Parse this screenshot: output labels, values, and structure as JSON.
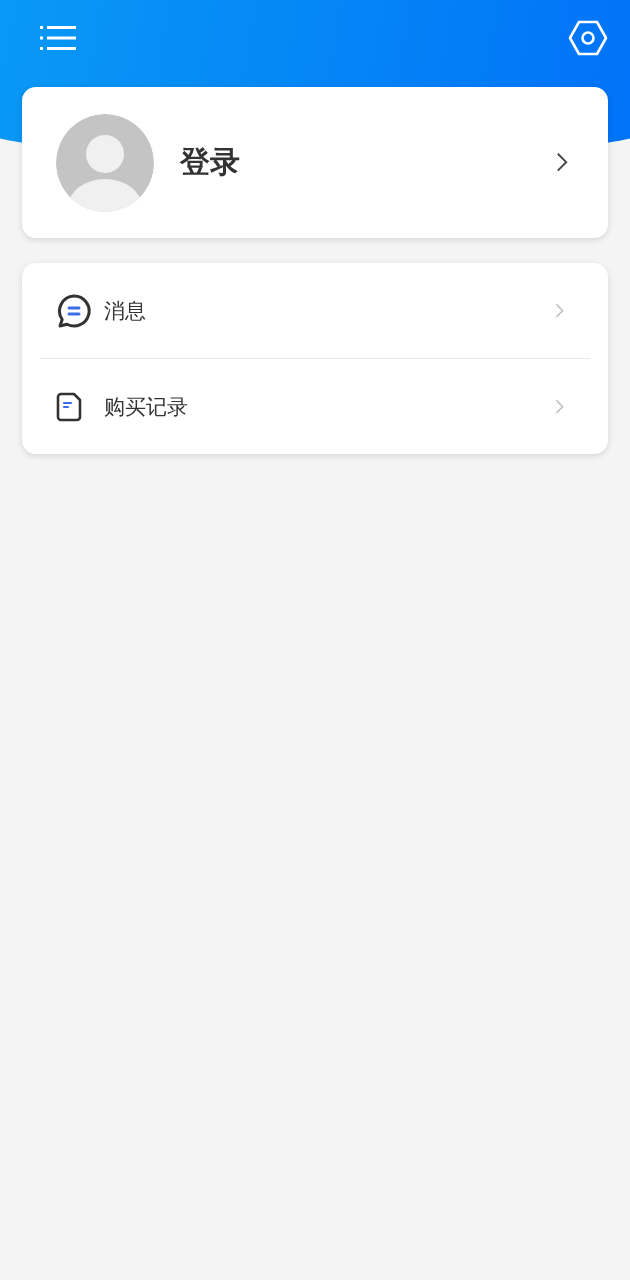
{
  "profile": {
    "label": "登录"
  },
  "menu": [
    {
      "kind": "message",
      "label": "消息"
    },
    {
      "kind": "record",
      "label": "购买记录"
    }
  ]
}
